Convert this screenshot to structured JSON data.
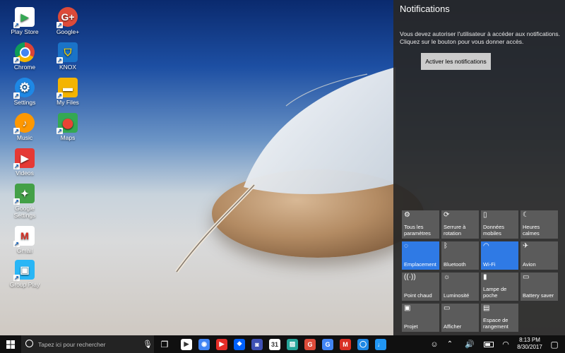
{
  "desktop_icons": [
    {
      "label": "Play Store",
      "icon": "play-store-icon",
      "color": "#ffffff"
    },
    {
      "label": "Google+",
      "icon": "google-plus-icon",
      "color": "#dd4b39"
    },
    {
      "label": "Chrome",
      "icon": "chrome-icon",
      "color": "#4285f4"
    },
    {
      "label": "KNOX",
      "icon": "knox-icon",
      "color": "#1a73c8"
    },
    {
      "label": "Settings",
      "icon": "settings-gear-icon",
      "color": "#1e88e5"
    },
    {
      "label": "My Files",
      "icon": "folder-icon",
      "color": "#f4b400"
    },
    {
      "label": "Music",
      "icon": "music-icon",
      "color": "#ff9800"
    },
    {
      "label": "Maps",
      "icon": "maps-icon",
      "color": "#34a853"
    },
    {
      "label": "Videos",
      "icon": "videos-icon",
      "color": "#e53935"
    },
    {
      "label": "Google Settings",
      "icon": "google-settings-icon",
      "color": "#43a047"
    },
    {
      "label": "Gmail",
      "icon": "gmail-icon",
      "color": "#ffffff"
    },
    {
      "label": "Group Play",
      "icon": "group-play-icon",
      "color": "#29b6f6"
    }
  ],
  "notifications": {
    "title": "Notifications",
    "message": "Vous devez autoriser l'utilisateur à accéder aux notifications. Cliquez sur le bouton pour vous donner accès.",
    "button": "Activer les notifications"
  },
  "quick_actions": [
    {
      "label": "Tous les paramètres",
      "icon": "settings-icon",
      "glyph": "⚙",
      "on": false
    },
    {
      "label": "Serrure à rotation",
      "icon": "rotation-lock-icon",
      "glyph": "⟳",
      "on": false
    },
    {
      "label": "Données mobiles",
      "icon": "mobile-data-icon",
      "glyph": "▯",
      "on": false
    },
    {
      "label": "Heures calmes",
      "icon": "moon-icon",
      "glyph": "☾",
      "on": false
    },
    {
      "label": "Emplacement",
      "icon": "location-icon",
      "glyph": "◌",
      "on": true
    },
    {
      "label": "Bluetooth",
      "icon": "bluetooth-icon",
      "glyph": "ᛒ",
      "on": false
    },
    {
      "label": "Wi-Fi",
      "icon": "wifi-icon",
      "glyph": "◠",
      "on": true
    },
    {
      "label": "Avion",
      "icon": "airplane-icon",
      "glyph": "✈",
      "on": false
    },
    {
      "label": "Point chaud",
      "icon": "hotspot-icon",
      "glyph": "((·))",
      "on": false
    },
    {
      "label": "Luminosité",
      "icon": "brightness-icon",
      "glyph": "☼",
      "on": false
    },
    {
      "label": "Lampe de poche",
      "icon": "flashlight-icon",
      "glyph": "▮",
      "on": false
    },
    {
      "label": "Battery saver",
      "icon": "battery-saver-icon",
      "glyph": "▭",
      "on": false
    },
    {
      "label": "Projet",
      "icon": "project-icon",
      "glyph": "▣",
      "on": false
    },
    {
      "label": "Afficher",
      "icon": "display-icon",
      "glyph": "▭",
      "on": false
    },
    {
      "label": "Espace de rangement",
      "icon": "storage-icon",
      "glyph": "▤",
      "on": false
    }
  ],
  "taskbar": {
    "search_placeholder": "Tapez ici pour rechercher",
    "apps": [
      {
        "icon": "play-store-icon",
        "glyph": "▶",
        "color": "#ffffff"
      },
      {
        "icon": "chrome-icon",
        "glyph": "◉",
        "color": "#4285f4"
      },
      {
        "icon": "youtube-icon",
        "glyph": "▶",
        "color": "#e52d27"
      },
      {
        "icon": "dropbox-icon",
        "glyph": "❖",
        "color": "#0061fe"
      },
      {
        "icon": "camera-icon",
        "glyph": "◙",
        "color": "#3f51b5"
      },
      {
        "icon": "calendar-icon",
        "glyph": "31",
        "color": "#ffffff"
      },
      {
        "icon": "gallery-icon",
        "glyph": "▨",
        "color": "#26a69a"
      },
      {
        "icon": "google-plus-icon",
        "glyph": "G",
        "color": "#dd4b39"
      },
      {
        "icon": "google-icon",
        "glyph": "G",
        "color": "#4285f4"
      },
      {
        "icon": "gmail-icon",
        "glyph": "M",
        "color": "#d93025"
      },
      {
        "icon": "messenger-icon",
        "glyph": "◯",
        "color": "#1e88e5"
      },
      {
        "icon": "voice-search-icon",
        "glyph": "♩",
        "color": "#2196f3"
      }
    ],
    "time": "8:13 PM",
    "date": "8/30/2017"
  }
}
